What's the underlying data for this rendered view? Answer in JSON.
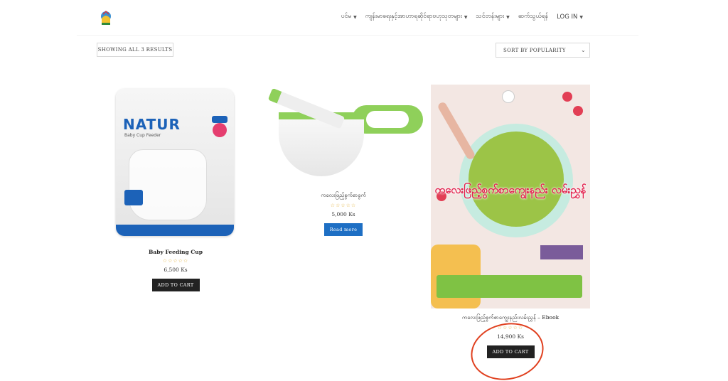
{
  "header": {
    "nav": [
      {
        "label": "ပင်မ",
        "has_caret": true
      },
      {
        "label": "ကျန်းမာရေးနှင့်အာဟာရဆိုင်ရာဗဟုသုတများ",
        "has_caret": true
      },
      {
        "label": "သင်တန်းများ",
        "has_caret": true
      },
      {
        "label": "ဆက်သွယ်ရန်",
        "has_caret": false
      },
      {
        "label": "LOG IN",
        "has_caret": true
      }
    ]
  },
  "toolbar": {
    "result_count": "SHOWING ALL 3 RESULTS",
    "sort_selected": "SORT BY POPULARITY"
  },
  "products": [
    {
      "title": "Baby Feeding Cup",
      "stars": "☆☆☆☆☆",
      "price": "6,500 Ks",
      "button": "ADD TO CART",
      "image_text": {
        "brand": "NATUR",
        "subtitle": "Baby Cup Feeder"
      }
    },
    {
      "title": "ကလေးဖြည့်စွက်စာခွက်",
      "stars": "☆☆☆☆☆",
      "price": "5,000 Ks",
      "button": "Read more"
    },
    {
      "title": "ကလေးဖြည့်စွက်စာကျွေးနည်းလမ်းညွှန် – Ebook",
      "stars": "☆☆☆☆☆",
      "price": "14,900 Ks",
      "button": "ADD TO CART",
      "image_text": {
        "title": "ကလေးဖြည့်စွက်စာကျွေးနည်း လမ်းညွှန်"
      }
    }
  ],
  "colors": {
    "accent_blue": "#1e6fc4",
    "annotation_red": "#e0401f",
    "button_dark": "#222222"
  }
}
